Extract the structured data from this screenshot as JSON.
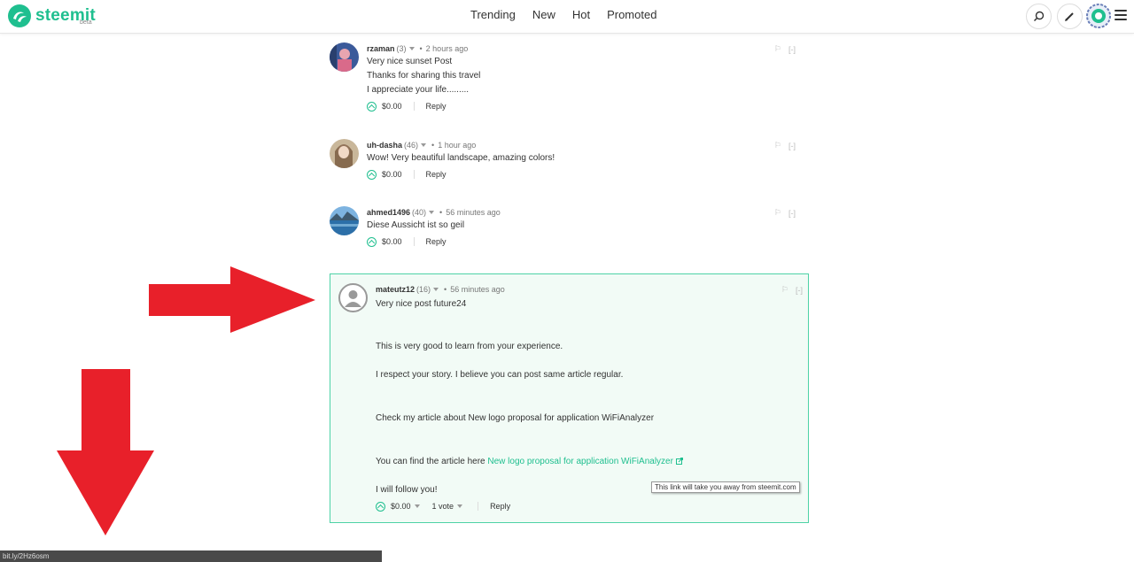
{
  "header": {
    "logo_text": "steemit",
    "logo_beta": "beta",
    "nav": [
      "Trending",
      "New",
      "Hot",
      "Promoted"
    ]
  },
  "comments": [
    {
      "author": "rzaman",
      "rep": "(3)",
      "time": "2 hours ago",
      "lines": [
        "Very nice sunset Post",
        "Thanks for sharing this travel",
        "I appreciate your life........."
      ],
      "payout": "$0.00",
      "reply": "Reply",
      "collapse": "[-]"
    },
    {
      "author": "uh-dasha",
      "rep": "(46)",
      "time": "1 hour ago",
      "lines": [
        "Wow! Very beautiful landscape, amazing colors!"
      ],
      "payout": "$0.00",
      "reply": "Reply",
      "collapse": "[-]"
    },
    {
      "author": "ahmed1496",
      "rep": "(40)",
      "time": "56 minutes ago",
      "lines": [
        "Diese Aussicht ist so geil"
      ],
      "payout": "$0.00",
      "reply": "Reply",
      "collapse": "[-]"
    },
    {
      "author": "mateutz12",
      "rep": "(16)",
      "time": "56 minutes ago",
      "lines": [
        "Very nice post future24",
        "This is very good to learn from your experience.",
        "I respect your story. I believe you can post same article regular.",
        "Check my article about New logo proposal for application WiFiAnalyzer",
        "You can find the article here",
        "I will follow you!"
      ],
      "link_text": "New logo proposal for application WiFiAnalyzer",
      "payout": "$0.00",
      "votes": "1 vote",
      "reply": "Reply",
      "collapse": "[-]"
    }
  ],
  "tooltip": "This link will take you away from steemit.com",
  "statusbar": "bit.ly/2Hz6osm",
  "colors": {
    "accent": "#1fbf8f",
    "arrow": "#e8202a",
    "highlight_bg": "#f2fbf6"
  }
}
